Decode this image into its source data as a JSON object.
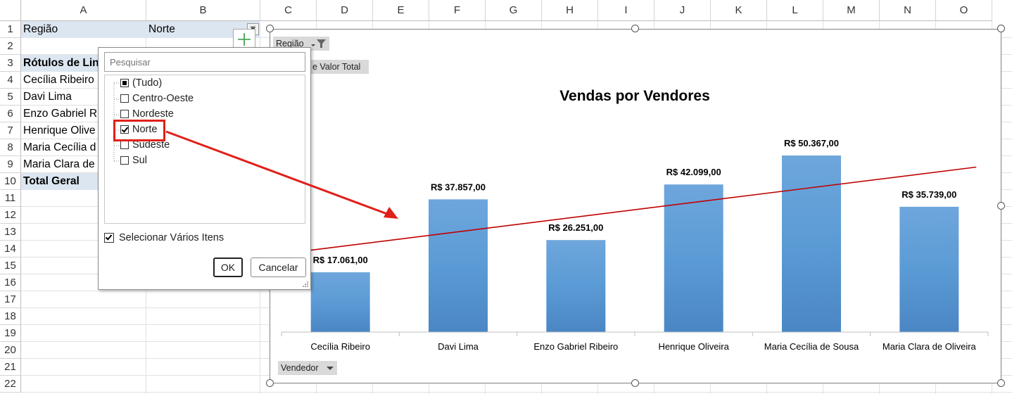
{
  "columns": [
    "A",
    "B",
    "C",
    "D",
    "E",
    "F",
    "G",
    "H",
    "I",
    "J",
    "K",
    "L",
    "M",
    "N",
    "O"
  ],
  "rows": [
    "1",
    "2",
    "3",
    "4",
    "5",
    "6",
    "7",
    "8",
    "9",
    "10",
    "11",
    "12",
    "13",
    "14",
    "15",
    "16",
    "17",
    "18",
    "19",
    "20",
    "21",
    "22"
  ],
  "sheet": {
    "filter_label": "Região",
    "filter_value": "Norte",
    "row_labels_header": "Rótulos de Lin",
    "names": [
      "Cecília Ribeiro",
      "Davi Lima",
      "Enzo Gabriel R",
      "Henrique Olive",
      "Maria Cecília d",
      "Maria Clara de"
    ],
    "total_label": "Total Geral"
  },
  "chart_fields": {
    "region_button": "Região",
    "value_button": "e Valor Total",
    "axis_button": "Vendedor"
  },
  "filter_dropdown": {
    "search_placeholder": "Pesquisar",
    "items": [
      {
        "label": "(Tudo)",
        "state": "mixed"
      },
      {
        "label": "Centro-Oeste",
        "state": "unchecked"
      },
      {
        "label": "Nordeste",
        "state": "unchecked"
      },
      {
        "label": "Norte",
        "state": "checked"
      },
      {
        "label": "Sudeste",
        "state": "unchecked"
      },
      {
        "label": "Sul",
        "state": "unchecked"
      }
    ],
    "multi_select_label": "Selecionar Vários Itens",
    "multi_select_checked": true,
    "ok_label": "OK",
    "cancel_label": "Cancelar"
  },
  "chart_data": {
    "type": "bar",
    "title": "Vendas por Vendores",
    "categories": [
      "Cecília Ribeiro",
      "Davi Lima",
      "Enzo Gabriel Ribeiro",
      "Henrique Oliveira",
      "Maria Cecília de Sousa",
      "Maria Clara de Oliveira"
    ],
    "values": [
      17061,
      37857,
      26251,
      42099,
      50367,
      35739
    ],
    "data_labels": [
      "R$ 17.061,00",
      "R$ 37.857,00",
      "R$ 26.251,00",
      "R$ 42.099,00",
      "R$ 50.367,00",
      "R$ 35.739,00"
    ],
    "trendline": "linear",
    "bar_color": "#5b9bd5",
    "trendline_color": "#c00000",
    "grid": false,
    "legend": "none"
  },
  "annotation": {
    "color": "#e0201a"
  }
}
